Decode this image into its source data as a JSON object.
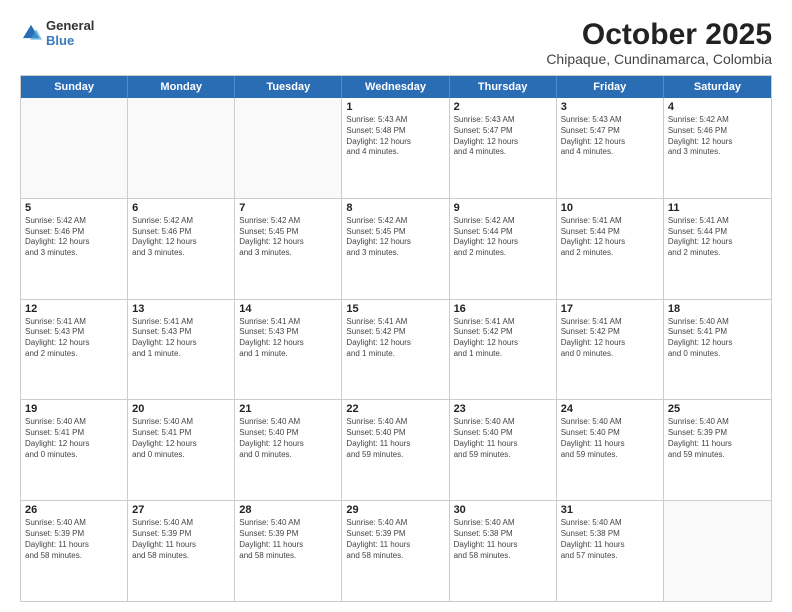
{
  "logo": {
    "general": "General",
    "blue": "Blue"
  },
  "title": "October 2025",
  "subtitle": "Chipaque, Cundinamarca, Colombia",
  "headers": [
    "Sunday",
    "Monday",
    "Tuesday",
    "Wednesday",
    "Thursday",
    "Friday",
    "Saturday"
  ],
  "rows": [
    [
      {
        "day": "",
        "detail": "",
        "empty": true
      },
      {
        "day": "",
        "detail": "",
        "empty": true
      },
      {
        "day": "",
        "detail": "",
        "empty": true
      },
      {
        "day": "1",
        "detail": "Sunrise: 5:43 AM\nSunset: 5:48 PM\nDaylight: 12 hours\nand 4 minutes."
      },
      {
        "day": "2",
        "detail": "Sunrise: 5:43 AM\nSunset: 5:47 PM\nDaylight: 12 hours\nand 4 minutes."
      },
      {
        "day": "3",
        "detail": "Sunrise: 5:43 AM\nSunset: 5:47 PM\nDaylight: 12 hours\nand 4 minutes."
      },
      {
        "day": "4",
        "detail": "Sunrise: 5:42 AM\nSunset: 5:46 PM\nDaylight: 12 hours\nand 3 minutes."
      }
    ],
    [
      {
        "day": "5",
        "detail": "Sunrise: 5:42 AM\nSunset: 5:46 PM\nDaylight: 12 hours\nand 3 minutes."
      },
      {
        "day": "6",
        "detail": "Sunrise: 5:42 AM\nSunset: 5:46 PM\nDaylight: 12 hours\nand 3 minutes."
      },
      {
        "day": "7",
        "detail": "Sunrise: 5:42 AM\nSunset: 5:45 PM\nDaylight: 12 hours\nand 3 minutes."
      },
      {
        "day": "8",
        "detail": "Sunrise: 5:42 AM\nSunset: 5:45 PM\nDaylight: 12 hours\nand 3 minutes."
      },
      {
        "day": "9",
        "detail": "Sunrise: 5:42 AM\nSunset: 5:44 PM\nDaylight: 12 hours\nand 2 minutes."
      },
      {
        "day": "10",
        "detail": "Sunrise: 5:41 AM\nSunset: 5:44 PM\nDaylight: 12 hours\nand 2 minutes."
      },
      {
        "day": "11",
        "detail": "Sunrise: 5:41 AM\nSunset: 5:44 PM\nDaylight: 12 hours\nand 2 minutes."
      }
    ],
    [
      {
        "day": "12",
        "detail": "Sunrise: 5:41 AM\nSunset: 5:43 PM\nDaylight: 12 hours\nand 2 minutes."
      },
      {
        "day": "13",
        "detail": "Sunrise: 5:41 AM\nSunset: 5:43 PM\nDaylight: 12 hours\nand 1 minute."
      },
      {
        "day": "14",
        "detail": "Sunrise: 5:41 AM\nSunset: 5:43 PM\nDaylight: 12 hours\nand 1 minute."
      },
      {
        "day": "15",
        "detail": "Sunrise: 5:41 AM\nSunset: 5:42 PM\nDaylight: 12 hours\nand 1 minute."
      },
      {
        "day": "16",
        "detail": "Sunrise: 5:41 AM\nSunset: 5:42 PM\nDaylight: 12 hours\nand 1 minute."
      },
      {
        "day": "17",
        "detail": "Sunrise: 5:41 AM\nSunset: 5:42 PM\nDaylight: 12 hours\nand 0 minutes."
      },
      {
        "day": "18",
        "detail": "Sunrise: 5:40 AM\nSunset: 5:41 PM\nDaylight: 12 hours\nand 0 minutes."
      }
    ],
    [
      {
        "day": "19",
        "detail": "Sunrise: 5:40 AM\nSunset: 5:41 PM\nDaylight: 12 hours\nand 0 minutes."
      },
      {
        "day": "20",
        "detail": "Sunrise: 5:40 AM\nSunset: 5:41 PM\nDaylight: 12 hours\nand 0 minutes."
      },
      {
        "day": "21",
        "detail": "Sunrise: 5:40 AM\nSunset: 5:40 PM\nDaylight: 12 hours\nand 0 minutes."
      },
      {
        "day": "22",
        "detail": "Sunrise: 5:40 AM\nSunset: 5:40 PM\nDaylight: 11 hours\nand 59 minutes."
      },
      {
        "day": "23",
        "detail": "Sunrise: 5:40 AM\nSunset: 5:40 PM\nDaylight: 11 hours\nand 59 minutes."
      },
      {
        "day": "24",
        "detail": "Sunrise: 5:40 AM\nSunset: 5:40 PM\nDaylight: 11 hours\nand 59 minutes."
      },
      {
        "day": "25",
        "detail": "Sunrise: 5:40 AM\nSunset: 5:39 PM\nDaylight: 11 hours\nand 59 minutes."
      }
    ],
    [
      {
        "day": "26",
        "detail": "Sunrise: 5:40 AM\nSunset: 5:39 PM\nDaylight: 11 hours\nand 58 minutes."
      },
      {
        "day": "27",
        "detail": "Sunrise: 5:40 AM\nSunset: 5:39 PM\nDaylight: 11 hours\nand 58 minutes."
      },
      {
        "day": "28",
        "detail": "Sunrise: 5:40 AM\nSunset: 5:39 PM\nDaylight: 11 hours\nand 58 minutes."
      },
      {
        "day": "29",
        "detail": "Sunrise: 5:40 AM\nSunset: 5:39 PM\nDaylight: 11 hours\nand 58 minutes."
      },
      {
        "day": "30",
        "detail": "Sunrise: 5:40 AM\nSunset: 5:38 PM\nDaylight: 11 hours\nand 58 minutes."
      },
      {
        "day": "31",
        "detail": "Sunrise: 5:40 AM\nSunset: 5:38 PM\nDaylight: 11 hours\nand 57 minutes."
      },
      {
        "day": "",
        "detail": "",
        "empty": true
      }
    ]
  ]
}
